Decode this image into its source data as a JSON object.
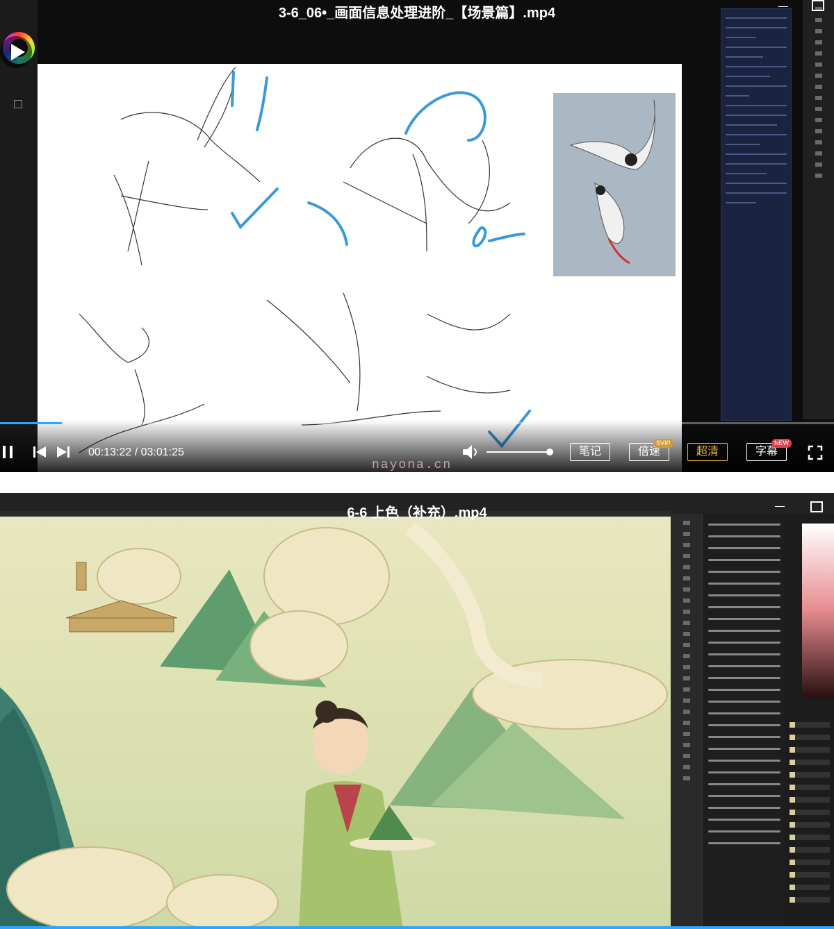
{
  "player1": {
    "title": "3-6_06•_画面信息处理进阶_【场景篇】.mp4",
    "time_current": "00:13:22",
    "time_separator": " / ",
    "time_total": "03:01:25",
    "progress": 0.074,
    "volume": 0.95,
    "buttons": {
      "notes": "笔记",
      "speed": "倍速",
      "speed_badge": "SVIP",
      "quality": "超清",
      "subtitles": "字幕",
      "subtitles_badge": "NEW"
    },
    "watermark": "nayona.cn",
    "colors": {
      "accent": "#2aa7ff",
      "quality": "#f0b33a",
      "svip": "#d19a3a",
      "new": "#e0404a"
    }
  },
  "player2": {
    "title": "6-6 上色（补充）.mp4",
    "progress": 1.0
  },
  "icons": [
    "play-icon",
    "previous-icon",
    "next-icon",
    "volume-icon",
    "fullscreen-icon",
    "minimize-icon",
    "maximize-icon",
    "color-wheel-icon"
  ]
}
